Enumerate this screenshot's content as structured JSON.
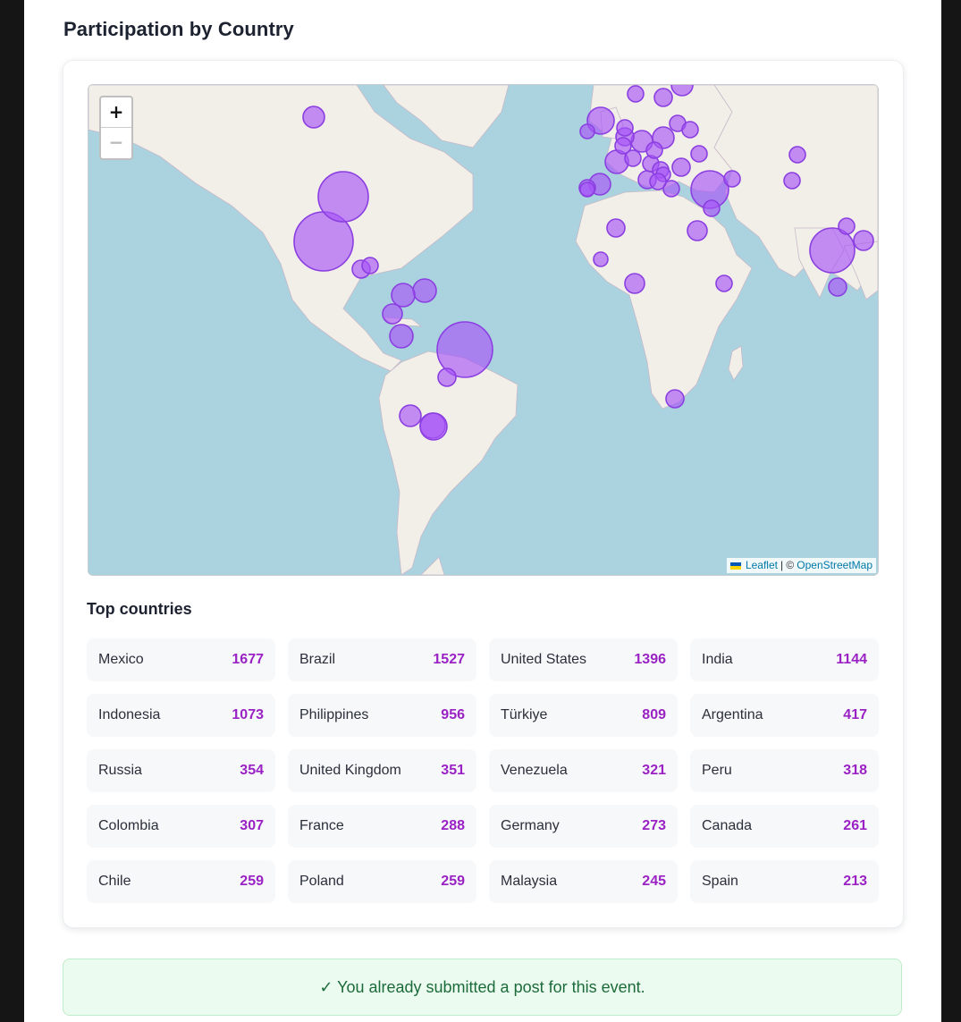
{
  "section": {
    "title": "Participation by Country"
  },
  "map": {
    "zoom_in_label": "+",
    "zoom_out_label": "−",
    "attribution": {
      "leaflet": "Leaflet",
      "separator": "| ©",
      "osm": "OpenStreetMap"
    },
    "bubble_fill": "#a855f7",
    "bubble_stroke": "#8b3fe0",
    "land_color": "#f2efe9",
    "water_color": "#aad3df"
  },
  "top_countries": {
    "title": "Top countries",
    "items": [
      {
        "name": "Mexico",
        "count": "1677"
      },
      {
        "name": "Brazil",
        "count": "1527"
      },
      {
        "name": "United States",
        "count": "1396"
      },
      {
        "name": "India",
        "count": "1144"
      },
      {
        "name": "Indonesia",
        "count": "1073"
      },
      {
        "name": "Philippines",
        "count": "956"
      },
      {
        "name": "Türkiye",
        "count": "809"
      },
      {
        "name": "Argentina",
        "count": "417"
      },
      {
        "name": "Russia",
        "count": "354"
      },
      {
        "name": "United Kingdom",
        "count": "351"
      },
      {
        "name": "Venezuela",
        "count": "321"
      },
      {
        "name": "Peru",
        "count": "318"
      },
      {
        "name": "Colombia",
        "count": "307"
      },
      {
        "name": "France",
        "count": "288"
      },
      {
        "name": "Germany",
        "count": "273"
      },
      {
        "name": "Canada",
        "count": "261"
      },
      {
        "name": "Chile",
        "count": "259"
      },
      {
        "name": "Poland",
        "count": "259"
      },
      {
        "name": "Malaysia",
        "count": "245"
      },
      {
        "name": "Spain",
        "count": "213"
      }
    ]
  },
  "notice": {
    "text": "✓ You already submitted a post for this event."
  }
}
